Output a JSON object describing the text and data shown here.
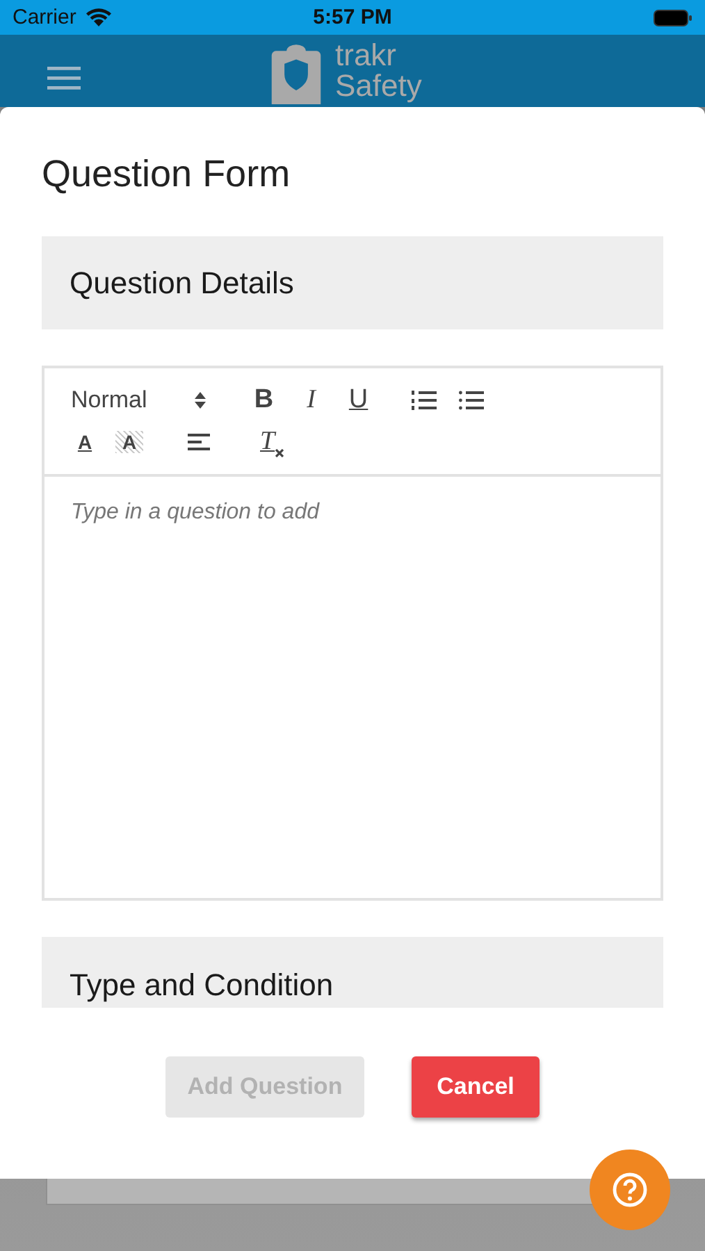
{
  "status_bar": {
    "carrier": "Carrier",
    "time": "5:57 PM"
  },
  "app_header": {
    "logo_line_1": "trakr",
    "logo_line_2": "Safety"
  },
  "dialog": {
    "title": "Question Form",
    "sections": [
      {
        "title": "Question Details"
      },
      {
        "title": "Type and Condition"
      }
    ],
    "editor": {
      "header_select": "Normal",
      "placeholder": "Type in a question to add",
      "toolbar_rows": [
        [
          {
            "kind": "bold",
            "label": "B"
          },
          {
            "kind": "italic",
            "label": "I"
          },
          {
            "kind": "underline",
            "label": "U"
          },
          {
            "kind": "ordered-list"
          },
          {
            "kind": "bullet-list"
          }
        ],
        [
          {
            "kind": "text-color",
            "label": "A"
          },
          {
            "kind": "background-color",
            "label": "A"
          },
          {
            "kind": "align"
          },
          {
            "kind": "clear-format",
            "label": "T"
          }
        ]
      ]
    },
    "buttons": [
      {
        "label": "Add Question",
        "kind": "primary",
        "disabled": true
      },
      {
        "label": "Cancel",
        "kind": "danger",
        "disabled": false
      }
    ]
  }
}
